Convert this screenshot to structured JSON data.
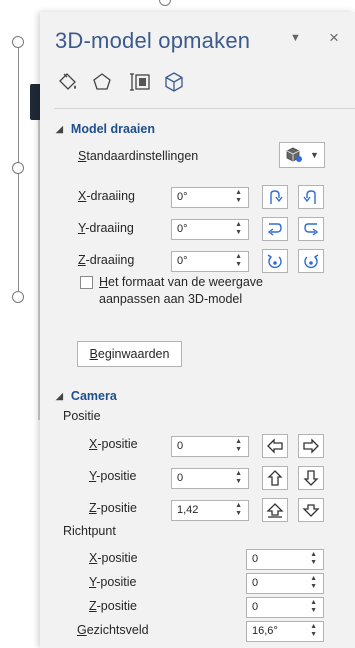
{
  "pane": {
    "title": "3D-model opmaken",
    "dropdown_icon": "caret-down",
    "close_icon": "×",
    "tabs": [
      {
        "name": "fill-line",
        "icon": "paint-bucket-icon"
      },
      {
        "name": "effects",
        "icon": "pentagon-icon"
      },
      {
        "name": "size-properties",
        "icon": "size-icon"
      },
      {
        "name": "3d-model",
        "icon": "cube-icon",
        "selected": true
      }
    ]
  },
  "model_rotation": {
    "header": "Model draaien",
    "presets": {
      "label_key": "S",
      "label_rest": "tandaardinstellingen"
    },
    "rows": [
      {
        "key": "X",
        "rest": "-draaiing",
        "value": "0°"
      },
      {
        "key": "Y",
        "rest": "-draaiing",
        "value": "0°"
      },
      {
        "key": "Z",
        "rest": "-draaiing",
        "value": "0°"
      }
    ],
    "checkbox": {
      "key": "H",
      "line1_rest": "et formaat van de weergave",
      "line2": "aanpassen aan 3D-model",
      "checked": false
    },
    "reset_button": {
      "key": "B",
      "rest": "eginwaarden"
    }
  },
  "camera": {
    "header": "Camera",
    "position_label": "Positie",
    "position_rows": [
      {
        "key": "X",
        "rest": "-positie",
        "value": "0"
      },
      {
        "key": "Y",
        "rest": "-positie",
        "value": "0"
      },
      {
        "key": "Z",
        "rest": "-positie",
        "value": "1,42"
      }
    ],
    "target_label": "Richtpunt",
    "target_rows": [
      {
        "key": "X",
        "rest": "-positie",
        "value": "0"
      },
      {
        "key": "Y",
        "rest": "-positie",
        "value": "0"
      },
      {
        "key": "Z",
        "rest": "-positie",
        "value": "0"
      }
    ],
    "fov": {
      "key": "G",
      "rest": "ezichtsveld",
      "value": "16,6°"
    }
  },
  "colors": {
    "accent": "#3b5b8c",
    "header_blue": "#1f4e8c",
    "pane_bg": "#f2f2f2"
  }
}
